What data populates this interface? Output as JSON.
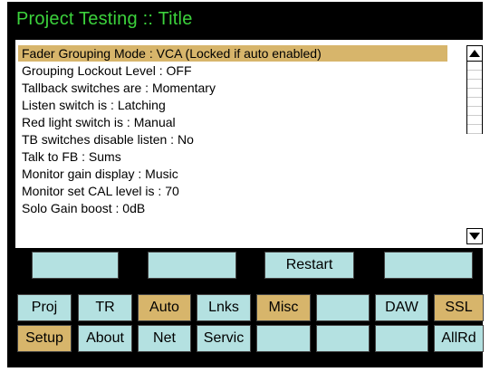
{
  "header": {
    "title": "Project Testing :: Title"
  },
  "settings_list": {
    "rows": [
      "Fader Grouping Mode  :  VCA     (Locked if auto enabled)",
      "Grouping Lockout Level  :  OFF",
      "Tallback switches are  :  Momentary",
      "Listen switch is  :  Latching",
      "Red light switch is  :  Manual",
      "TB switches disable listen  :  No",
      "Talk to FB  :  Sums",
      "Monitor gain display  :  Music",
      "Monitor set CAL level is  :  70",
      "Solo Gain boost  :  0dB"
    ],
    "selected_index": 0
  },
  "action_row": {
    "restart_label": "Restart"
  },
  "nav_row1": [
    "Proj",
    "TR",
    "Auto",
    "Lnks",
    "Misc",
    "",
    "DAW",
    "SSL"
  ],
  "nav_row2": [
    "Setup",
    "About",
    "Net",
    "Servic",
    "",
    "",
    "",
    "AllRd"
  ],
  "colors": {
    "background": "#000000",
    "title": "#3cd23c",
    "button_blue": "#b4e1e1",
    "button_gold": "#d7b56b",
    "selection": "#d7b56b"
  },
  "icons": {
    "scroll_up": "triangle-up-icon",
    "scroll_down": "triangle-down-icon"
  }
}
